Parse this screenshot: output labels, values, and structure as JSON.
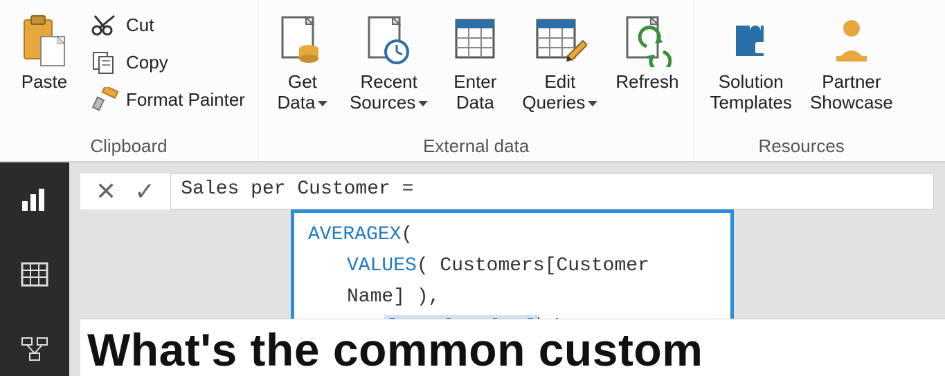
{
  "ribbon": {
    "clipboard": {
      "label": "Clipboard",
      "paste": "Paste",
      "cut": "Cut",
      "copy": "Copy",
      "format_painter": "Format Painter"
    },
    "external_data": {
      "label": "External data",
      "get_data": "Get\nData",
      "recent_sources": "Recent\nSources",
      "enter_data": "Enter\nData",
      "edit_queries": "Edit\nQueries",
      "refresh": "Refresh"
    },
    "resources": {
      "label": "Resources",
      "solution_templates": "Solution\nTemplates",
      "partner_showcase": "Partner\nShowcase"
    }
  },
  "sidebar": {
    "report": "report-view",
    "data": "data-view",
    "model": "model-view"
  },
  "formula": {
    "header": "Sales per Customer =",
    "line1_func": "AVERAGEX",
    "line1_paren": "(",
    "line2_func": "VALUES",
    "line2_body": "( Customers[Customer Name] ),",
    "line3_measure": "[Total Sales]",
    "line3_tail": " )"
  },
  "headline": "What's the common custom"
}
